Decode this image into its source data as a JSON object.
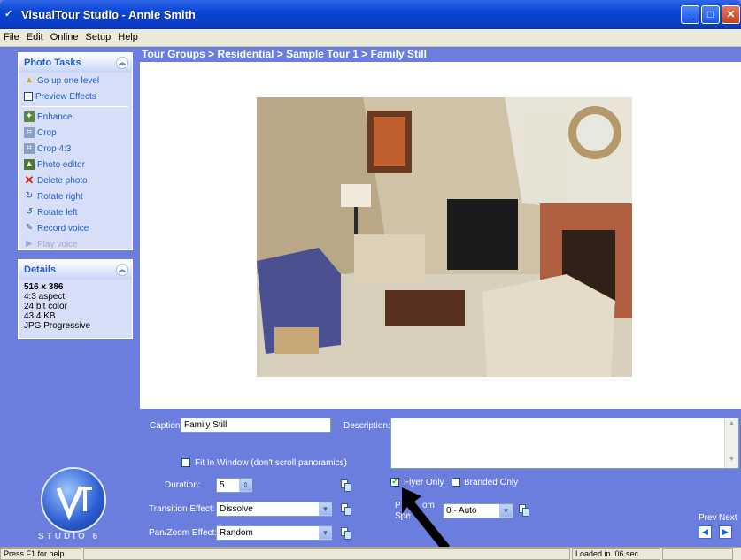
{
  "window": {
    "title": "VisualTour Studio - Annie Smith",
    "minimize": "_",
    "maximize": "□",
    "close": "✕"
  },
  "menu": [
    "File",
    "Edit",
    "Online",
    "Setup",
    "Help"
  ],
  "photo_tasks": {
    "title": "Photo Tasks",
    "items": [
      {
        "label": "Go up one level",
        "icon": "folder-up-icon"
      },
      {
        "label": "Preview Effects",
        "icon": "checkbox"
      },
      {
        "label": "Enhance",
        "icon": "enhance-icon"
      },
      {
        "label": "Crop",
        "icon": "crop-icon"
      },
      {
        "label": "Crop 4:3",
        "icon": "crop-icon"
      },
      {
        "label": "Photo editor",
        "icon": "photo-editor-icon"
      },
      {
        "label": "Delete photo",
        "icon": "delete-icon"
      },
      {
        "label": "Rotate right",
        "icon": "rotate-right-icon"
      },
      {
        "label": "Rotate left",
        "icon": "rotate-left-icon"
      },
      {
        "label": "Record voice",
        "icon": "microphone-icon"
      },
      {
        "label": "Play voice",
        "icon": "play-icon",
        "disabled": true
      }
    ]
  },
  "details": {
    "title": "Details",
    "dimensions": "516 x 386",
    "lines": [
      "4:3 aspect",
      "24 bit color",
      "43.4 KB",
      "JPG Progressive"
    ]
  },
  "breadcrumb": "Tour Groups > Residential > Sample Tour 1 > Family Still",
  "form": {
    "caption_label": "Caption:",
    "caption_value": "Family Still",
    "description_label": "Description:",
    "fit_in_window_label": "Fit In Window (don't scroll panoramics)",
    "duration_label": "Duration:",
    "duration_value": "5",
    "transition_label": "Transition Effect:",
    "transition_value": "Dissolve",
    "panzoom_label": "Pan/Zoom Effect:",
    "panzoom_value": "Random",
    "flyer_only_label": "Flyer Only",
    "flyer_only_checked": true,
    "branded_only_label": "Branded Only",
    "panzoom_speed_label_1": "P",
    "panzoom_speed_label_2": "om",
    "panzoom_speed_label_3": "Spe",
    "panzoom_speed_value": "0 - Auto"
  },
  "nav": {
    "prev_label": "Prev",
    "next_label": "Next"
  },
  "logo_text": "STUDIO 6",
  "status": {
    "help": "Press F1 for help",
    "loaded": "Loaded in .06 sec"
  }
}
